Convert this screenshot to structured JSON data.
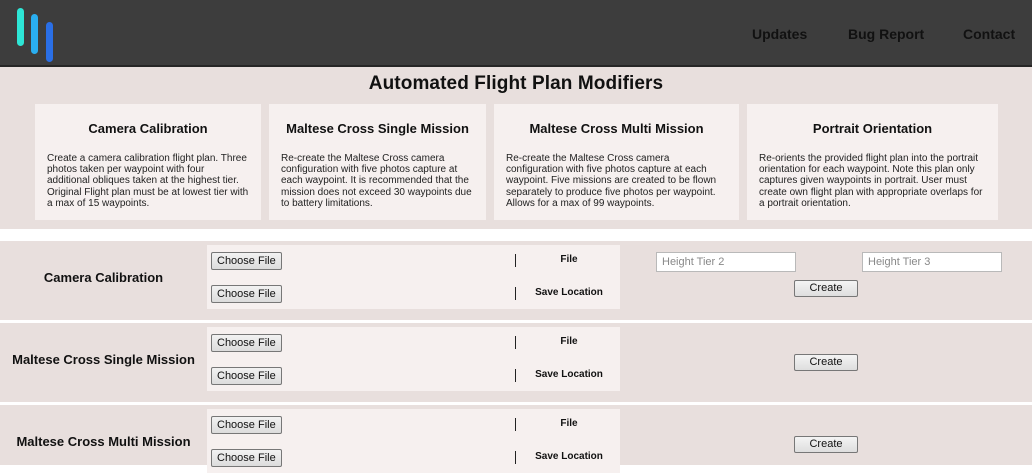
{
  "nav": {
    "links": [
      {
        "label": "Updates"
      },
      {
        "label": "Bug Report"
      },
      {
        "label": "Contact"
      }
    ]
  },
  "brand": {
    "logo_colors": [
      "#2ee6d6",
      "#2aaef0",
      "#2a6fe6"
    ]
  },
  "hero": {
    "title": "Automated Flight Plan Modifiers",
    "cards": [
      {
        "title": "Camera Calibration",
        "description": "Create a camera calibration flight plan. Three photos taken per waypoint with four additional obliques taken at the highest tier. Original Flight plan must be at lowest tier with a max of 15 waypoints."
      },
      {
        "title": "Maltese Cross Single Mission",
        "description": "Re-create the Maltese Cross camera configuration with five photos capture at each waypoint. It is recommended that the mission does not exceed 30 waypoints due to battery limitations."
      },
      {
        "title": "Maltese Cross Multi Mission",
        "description": "Re-create the Maltese Cross camera configuration with five photos capture at each waypoint. Five missions are created to be flown separately to produce five photos per waypoint. Allows for a max of 99 waypoints."
      },
      {
        "title": "Portrait Orientation",
        "description": "Re-orients the provided flight plan into the portrait orientation for each waypoint. Note this plan only captures given waypoints in portrait. User must create own flight plan with appropriate overlaps for a portrait orientation."
      }
    ]
  },
  "sections": [
    {
      "title": "Camera Calibration",
      "file_button": "Choose File",
      "file_label": "File",
      "save_button": "Choose File",
      "save_label": "Save Location",
      "height_tier_2_placeholder": "Height Tier 2",
      "height_tier_3_placeholder": "Height Tier 3",
      "create_label": "Create"
    },
    {
      "title": "Maltese Cross Single Mission",
      "file_button": "Choose File",
      "file_label": "File",
      "save_button": "Choose File",
      "save_label": "Save Location",
      "create_label": "Create"
    },
    {
      "title": "Maltese Cross Multi Mission",
      "file_button": "Choose File",
      "file_label": "File",
      "save_button": "Choose File",
      "save_label": "Save Location",
      "create_label": "Create"
    }
  ]
}
